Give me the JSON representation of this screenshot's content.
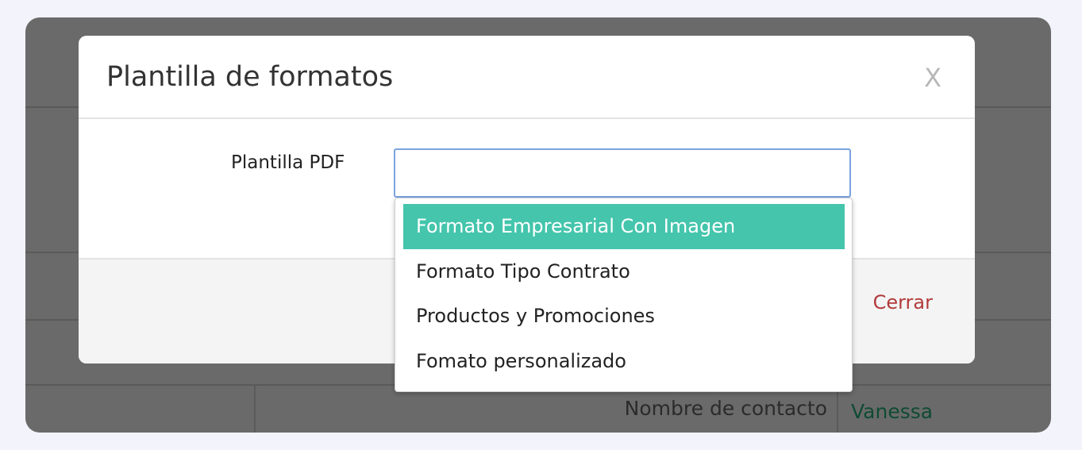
{
  "modal": {
    "title": "Plantilla de formatos",
    "close_label": "X",
    "field_label": "Plantilla PDF",
    "select_value": "",
    "footer_close_label": "Cerrar"
  },
  "dropdown": {
    "options": [
      {
        "label": "Formato Empresarial Con Imagen",
        "selected": true
      },
      {
        "label": "Formato Tipo Contrato",
        "selected": false
      },
      {
        "label": "Productos y Promociones",
        "selected": false
      },
      {
        "label": "Fomato personalizado",
        "selected": false
      }
    ],
    "highlight_color": "#44c5ac"
  },
  "background": {
    "contact_label": "Nombre de contacto",
    "contact_value": "Vanessa"
  },
  "colors": {
    "overlay": "#6a6a6a",
    "close_text": "#b23a3a",
    "select_border": "#7aa4e0"
  }
}
